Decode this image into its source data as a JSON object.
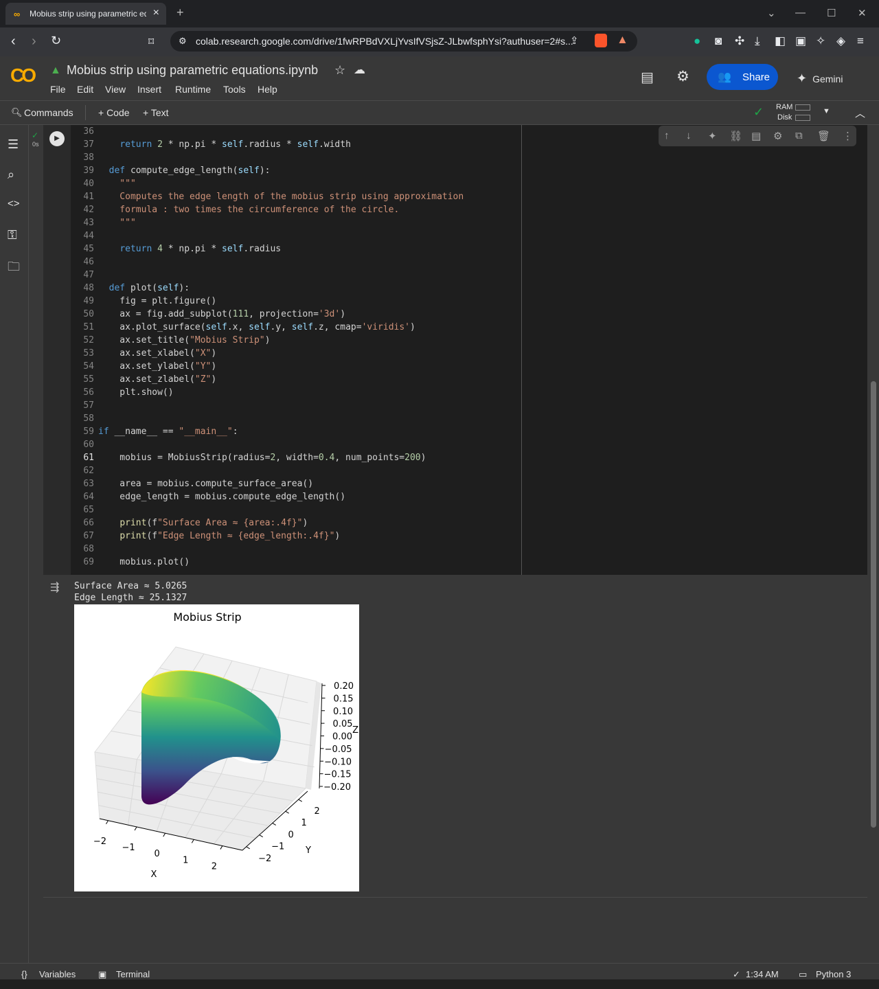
{
  "browser": {
    "tab_title": "Mobius strip using parametric equations.ipynb",
    "url": "colab.research.google.com/drive/1fwRPBdVXLjYvsIfVSjsZ-JLbwfsphYsi?authuser=2#s..."
  },
  "colab": {
    "logo": "CO",
    "notebook_title": "Mobius strip using parametric equations.ipynb",
    "menu": [
      "File",
      "Edit",
      "View",
      "Insert",
      "Runtime",
      "Tools",
      "Help"
    ],
    "share_label": "Share",
    "gemini_label": "Gemini",
    "toolbar": {
      "commands": "Commands",
      "code": "+ Code",
      "text": "+ Text",
      "ram": "RAM",
      "disk": "Disk"
    }
  },
  "cell": {
    "exec_time": "0s",
    "lines": [
      {
        "n": "36",
        "t": ""
      },
      {
        "n": "37",
        "t": "    return 2 * np.pi * self.radius * self.width"
      },
      {
        "n": "38",
        "t": ""
      },
      {
        "n": "39",
        "t": "  def compute_edge_length(self):"
      },
      {
        "n": "40",
        "t": "    \"\"\""
      },
      {
        "n": "41",
        "t": "    Computes the edge length of the mobius strip using approximation"
      },
      {
        "n": "42",
        "t": "    formula : two times the circumference of the circle."
      },
      {
        "n": "43",
        "t": "    \"\"\""
      },
      {
        "n": "44",
        "t": ""
      },
      {
        "n": "45",
        "t": "    return 4 * np.pi * self.radius"
      },
      {
        "n": "46",
        "t": ""
      },
      {
        "n": "47",
        "t": ""
      },
      {
        "n": "48",
        "t": "  def plot(self):"
      },
      {
        "n": "49",
        "t": "    fig = plt.figure()"
      },
      {
        "n": "50",
        "t": "    ax = fig.add_subplot(111, projection='3d')"
      },
      {
        "n": "51",
        "t": "    ax.plot_surface(self.x, self.y, self.z, cmap='viridis')"
      },
      {
        "n": "52",
        "t": "    ax.set_title(\"Mobius Strip\")"
      },
      {
        "n": "53",
        "t": "    ax.set_xlabel(\"X\")"
      },
      {
        "n": "54",
        "t": "    ax.set_ylabel(\"Y\")"
      },
      {
        "n": "55",
        "t": "    ax.set_zlabel(\"Z\")"
      },
      {
        "n": "56",
        "t": "    plt.show()"
      },
      {
        "n": "57",
        "t": ""
      },
      {
        "n": "58",
        "t": ""
      },
      {
        "n": "59",
        "t": "if __name__ == \"__main__\":"
      },
      {
        "n": "60",
        "t": ""
      },
      {
        "n": "61",
        "t": "    mobius = MobiusStrip(radius=2, width=0.4, num_points=200)"
      },
      {
        "n": "62",
        "t": ""
      },
      {
        "n": "63",
        "t": "    area = mobius.compute_surface_area()"
      },
      {
        "n": "64",
        "t": "    edge_length = mobius.compute_edge_length()"
      },
      {
        "n": "65",
        "t": ""
      },
      {
        "n": "66",
        "t": "    print(f\"Surface Area ≈ {area:.4f}\")"
      },
      {
        "n": "67",
        "t": "    print(f\"Edge Length ≈ {edge_length:.4f}\")"
      },
      {
        "n": "68",
        "t": ""
      },
      {
        "n": "69",
        "t": "    mobius.plot()"
      }
    ]
  },
  "output": {
    "lines": [
      "Surface Area ≈ 5.0265",
      "Edge Length ≈ 25.1327"
    ],
    "chart_data": {
      "type": "surface3d",
      "title": "Mobius Strip",
      "xlabel": "X",
      "ylabel": "Y",
      "zlabel": "Z",
      "xticks": [
        "−2",
        "−1",
        "0",
        "1",
        "2"
      ],
      "yticks": [
        "−2",
        "−1",
        "0",
        "1",
        "2"
      ],
      "zticks": [
        "0.20",
        "0.15",
        "0.10",
        "0.05",
        "0.00",
        "−0.05",
        "−0.10",
        "−0.15",
        "−0.20"
      ],
      "xlim": [
        -2,
        2
      ],
      "ylim": [
        -2,
        2
      ],
      "zlim": [
        -0.2,
        0.2
      ],
      "colormap": "viridis"
    }
  },
  "status": {
    "variables": "Variables",
    "terminal": "Terminal",
    "time": "1:34 AM",
    "runtime": "Python 3"
  }
}
